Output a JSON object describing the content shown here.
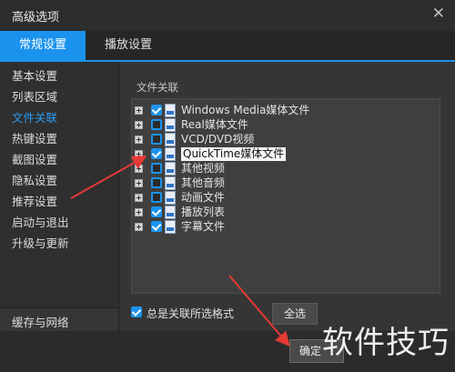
{
  "window": {
    "title": "高级选项",
    "close_glyph": "✕"
  },
  "tabs": [
    {
      "label": "常规设置",
      "active": true
    },
    {
      "label": "播放设置",
      "active": false
    }
  ],
  "sidebar": {
    "items": [
      {
        "label": "基本设置"
      },
      {
        "label": "列表区域"
      },
      {
        "label": "文件关联",
        "active": true
      },
      {
        "label": "热键设置"
      },
      {
        "label": "截图设置"
      },
      {
        "label": "隐私设置"
      },
      {
        "label": "推荐设置"
      },
      {
        "label": "启动与退出"
      },
      {
        "label": "升级与更新"
      }
    ],
    "bottom_item": "缓存与网络"
  },
  "file_assoc": {
    "section_label": "文件关联",
    "rows": [
      {
        "label": "Windows Media媒体文件",
        "checked": true
      },
      {
        "label": "Real媒体文件",
        "checked": false
      },
      {
        "label": "VCD/DVD视频",
        "checked": false
      },
      {
        "label": "QuickTime媒体文件",
        "checked": true,
        "highlighted": true
      },
      {
        "label": "其他视频",
        "checked": false
      },
      {
        "label": "其他音频",
        "checked": false
      },
      {
        "label": "动画文件",
        "checked": false
      },
      {
        "label": "播放列表",
        "checked": true
      },
      {
        "label": "字幕文件",
        "checked": true
      }
    ],
    "always_assoc_label": "总是关联所选格式",
    "always_assoc_checked": true,
    "select_all_label": "全选"
  },
  "footer": {
    "ok_label": "确定"
  },
  "watermark": "软件技巧",
  "colors": {
    "accent": "#1b93ee",
    "arrow": "#e53935"
  }
}
